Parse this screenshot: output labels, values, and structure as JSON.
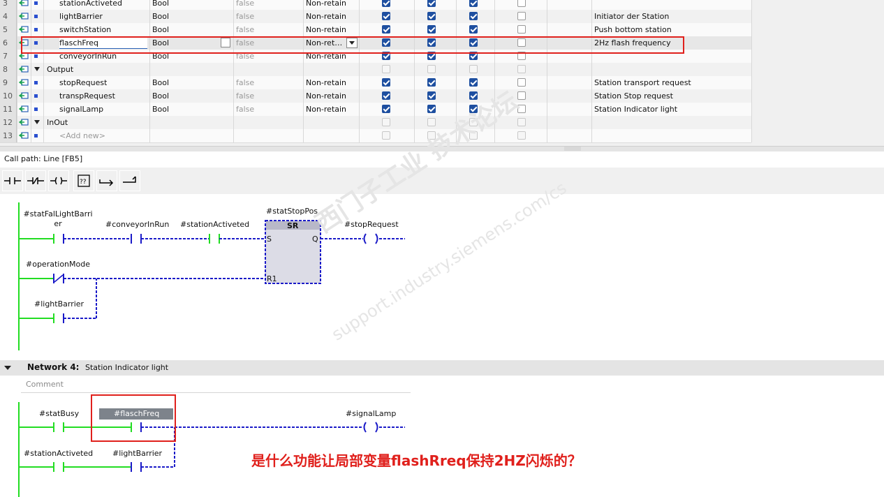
{
  "table": {
    "rows": [
      {
        "num": "3",
        "name": "stationActiveted",
        "type": "Bool",
        "default": "false",
        "retain": "Non-retain",
        "c1": true,
        "c2": true,
        "c3": true,
        "c4": false,
        "comment": "",
        "kind": "var"
      },
      {
        "num": "4",
        "name": "lightBarrier",
        "type": "Bool",
        "default": "false",
        "retain": "Non-retain",
        "c1": true,
        "c2": true,
        "c3": true,
        "c4": false,
        "comment": "Initiator der Station",
        "kind": "var"
      },
      {
        "num": "5",
        "name": "switchStation",
        "type": "Bool",
        "default": "false",
        "retain": "Non-retain",
        "c1": true,
        "c2": true,
        "c3": true,
        "c4": false,
        "comment": "Push bottom station",
        "kind": "var"
      },
      {
        "num": "6",
        "name": "flaschFreq",
        "type": "Bool",
        "default": "false",
        "retain": "Non-ret…",
        "c1": true,
        "c2": true,
        "c3": true,
        "c4": false,
        "comment": "2Hz flash frequency",
        "kind": "var-selected"
      },
      {
        "num": "7",
        "name": "conveyorInRun",
        "type": "Bool",
        "default": "false",
        "retain": "Non-retain",
        "c1": true,
        "c2": true,
        "c3": true,
        "c4": false,
        "comment": "",
        "kind": "var"
      },
      {
        "num": "8",
        "name": "Output",
        "type": "",
        "default": "",
        "retain": "",
        "c1": false,
        "c2": false,
        "c3": false,
        "c4": false,
        "comment": "",
        "kind": "section"
      },
      {
        "num": "9",
        "name": "stopRequest",
        "type": "Bool",
        "default": "false",
        "retain": "Non-retain",
        "c1": true,
        "c2": true,
        "c3": true,
        "c4": false,
        "comment": "Station transport request",
        "kind": "var"
      },
      {
        "num": "10",
        "name": "transpRequest",
        "type": "Bool",
        "default": "false",
        "retain": "Non-retain",
        "c1": true,
        "c2": true,
        "c3": true,
        "c4": false,
        "comment": "Station Stop request",
        "kind": "var"
      },
      {
        "num": "11",
        "name": "signalLamp",
        "type": "Bool",
        "default": "false",
        "retain": "Non-retain",
        "c1": true,
        "c2": true,
        "c3": true,
        "c4": false,
        "comment": "Station Indicator light",
        "kind": "var"
      },
      {
        "num": "12",
        "name": "InOut",
        "type": "",
        "default": "",
        "retain": "",
        "c1": false,
        "c2": false,
        "c3": false,
        "c4": false,
        "comment": "",
        "kind": "section"
      },
      {
        "num": "13",
        "name": "<Add new>",
        "type": "",
        "default": "",
        "retain": "",
        "c1": false,
        "c2": false,
        "c3": false,
        "c4": false,
        "comment": "",
        "kind": "addnew"
      }
    ]
  },
  "call_path": "Call path: Line [FB5]",
  "network3": {
    "contacts": [
      "#statFalLightBarri\ner",
      "#conveyorInRun",
      "#stationActiveted",
      "#operationMode",
      "#lightBarrier"
    ],
    "block_name": "#statStopPos",
    "block_type": "SR",
    "pin_s": "S",
    "pin_r1": "R1",
    "pin_q": "Q",
    "coil": "#stopRequest"
  },
  "network4": {
    "title": "Network 4:",
    "subtitle": "Station Indicator light",
    "comment_placeholder": "Comment",
    "contacts": [
      "#statBusy",
      "#flaschFreq",
      "#stationActiveted",
      "#lightBarrier"
    ],
    "coil": "#signalLamp"
  },
  "question": "是什么功能让局部变量flashRreq保持2HZ闪烁的？",
  "watermark": [
    "西门子工业  技术论坛",
    "support.industry.siemens.com/cs"
  ],
  "colors": {
    "power": "#22dd22",
    "wire": "#1a1ac8",
    "highlight": "#e0201c",
    "check": "#1e4fa0"
  }
}
